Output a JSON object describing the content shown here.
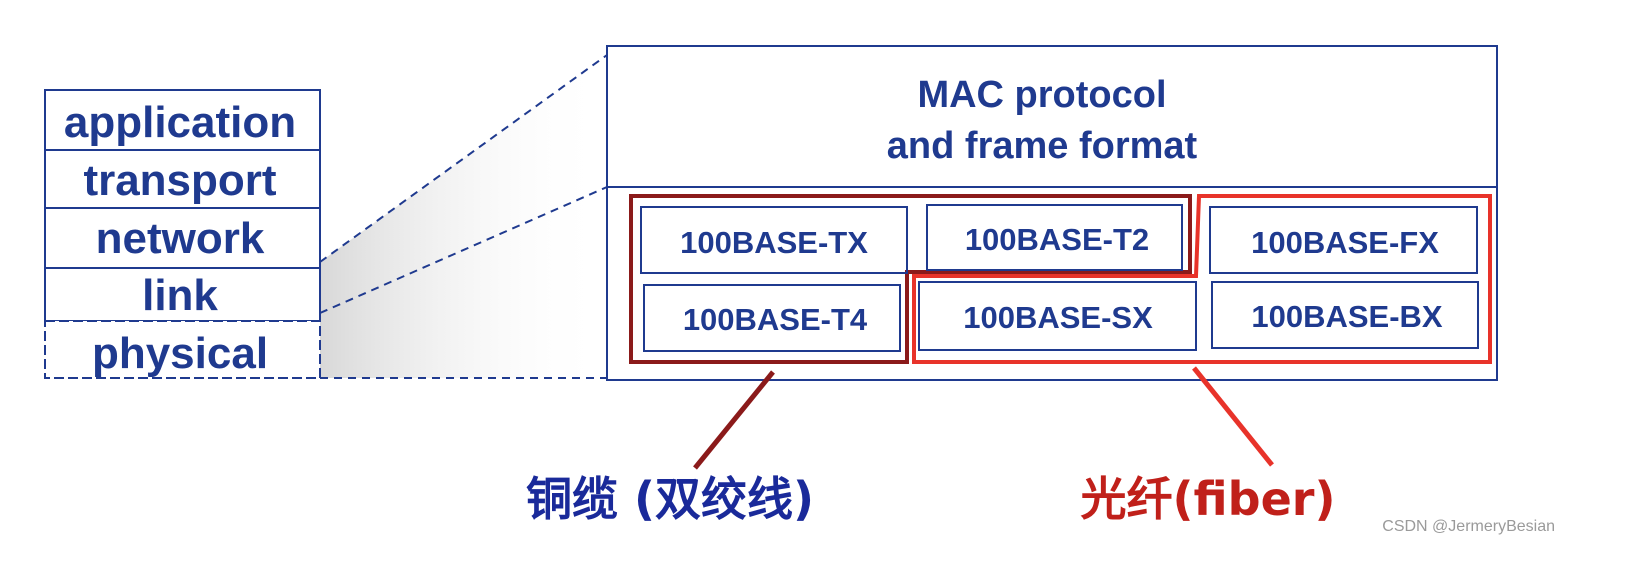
{
  "colors": {
    "blue": "#1f3a8f",
    "copper": "#8b1a1a",
    "fiber": "#e8332a",
    "watermark": "#9a9a9a"
  },
  "stack": {
    "layers": [
      "application",
      "transport",
      "network",
      "link",
      "physical"
    ]
  },
  "mac": {
    "line1": "MAC protocol",
    "line2": "and frame format"
  },
  "standards": {
    "tx": "100BASE-TX",
    "t2": "100BASE-T2",
    "fx": "100BASE-FX",
    "t4": "100BASE-T4",
    "sx": "100BASE-SX",
    "bx": "100BASE-BX"
  },
  "labels": {
    "copper": "铜缆 (双绞线)",
    "fiber": "光纤(fiber)"
  },
  "watermark": "CSDN @JermeryBesian"
}
